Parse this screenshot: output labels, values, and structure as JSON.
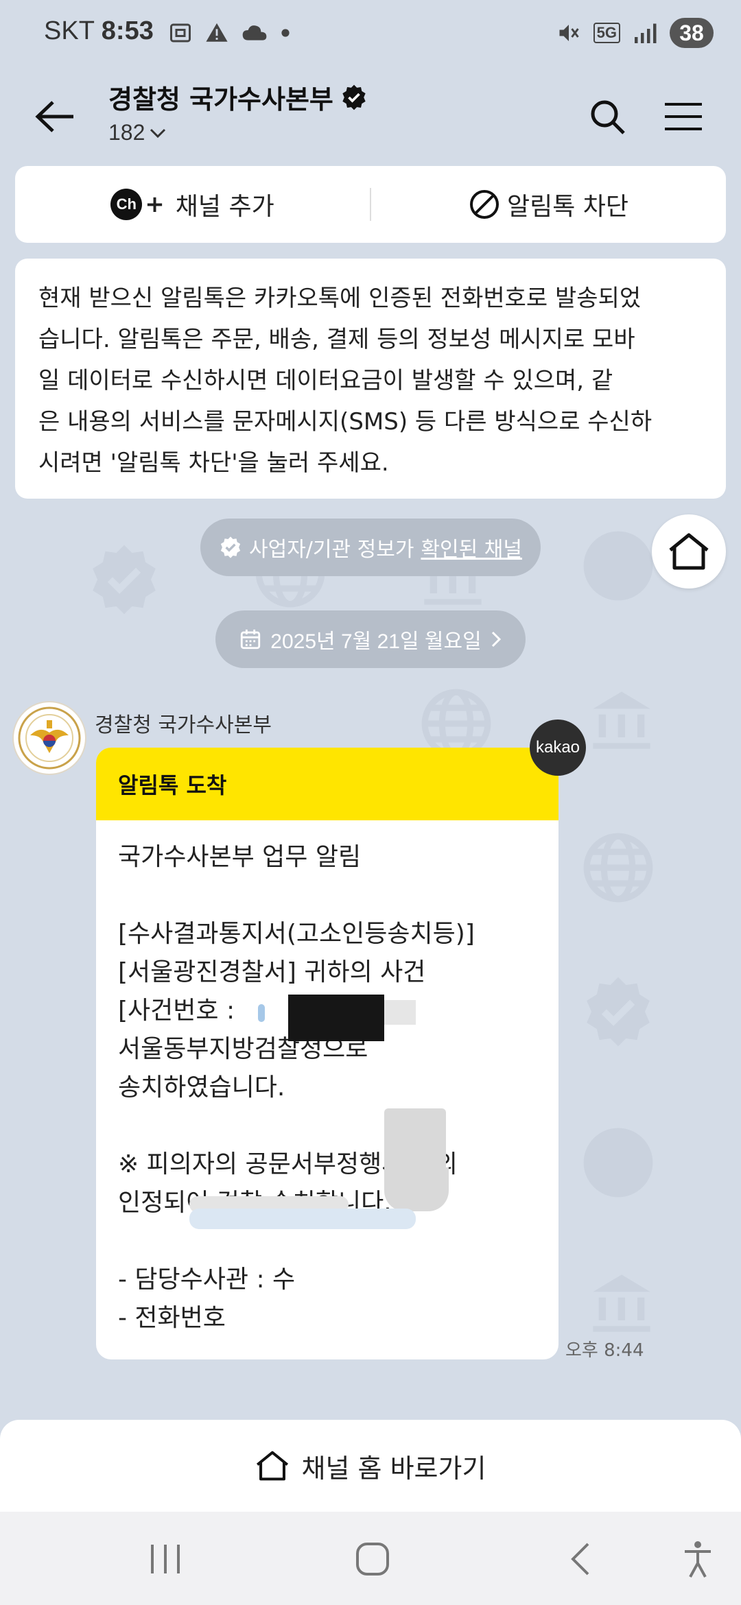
{
  "status_bar": {
    "carrier": "SKT",
    "time": "8:53",
    "network": "5G",
    "battery": "38"
  },
  "header": {
    "title": "경찰청 국가수사본부",
    "subtitle": "182"
  },
  "actions": {
    "add_channel": "채널 추가",
    "block": "알림톡 차단",
    "ch_badge": "Ch"
  },
  "notice": {
    "lines": [
      "현재 받으신 알림톡은 카카오톡에 인증된 전화번호로 발송되었",
      "습니다. 알림톡은 주문, 배송, 결제 등의 정보성 메시지로 모바",
      "일 데이터로 수신하시면 데이터요금이 발생할 수 있으며, 같",
      "은 내용의 서비스를 문자메시지(SMS) 등 다른 방식으로 수신하",
      "시려면 '알림톡 차단'을 눌러 주세요."
    ]
  },
  "verified": {
    "text": "사업자/기관 정보가",
    "link": "확인된 채널"
  },
  "date": {
    "label": "2025년 7월 21일 월요일"
  },
  "message": {
    "sender": "경찰청 국가수사본부",
    "header": "알림톡 도착",
    "badge": "kakao",
    "time": "오후 8:44",
    "lines": [
      "국가수사본부 업무 알림",
      "",
      "[수사결과통지서(고소인등송치등)]",
      "[서울광진경찰서] 귀하의 사건",
      "[사건번호 :",
      "서울동부지방검찰청으로",
      "송치하였습니다.",
      "",
      "※ 피의자의 공문서부정행사 혐의",
      "인정되어 검찰 송치합니다.",
      "",
      "- 담당수사관 : 수",
      "- 전화번호"
    ]
  },
  "bottom": {
    "home_shortcut": "채널 홈 바로가기"
  },
  "colors": {
    "background": "#d4dce7",
    "bubble_header": "#ffe500",
    "pill": "#b6bec9"
  }
}
